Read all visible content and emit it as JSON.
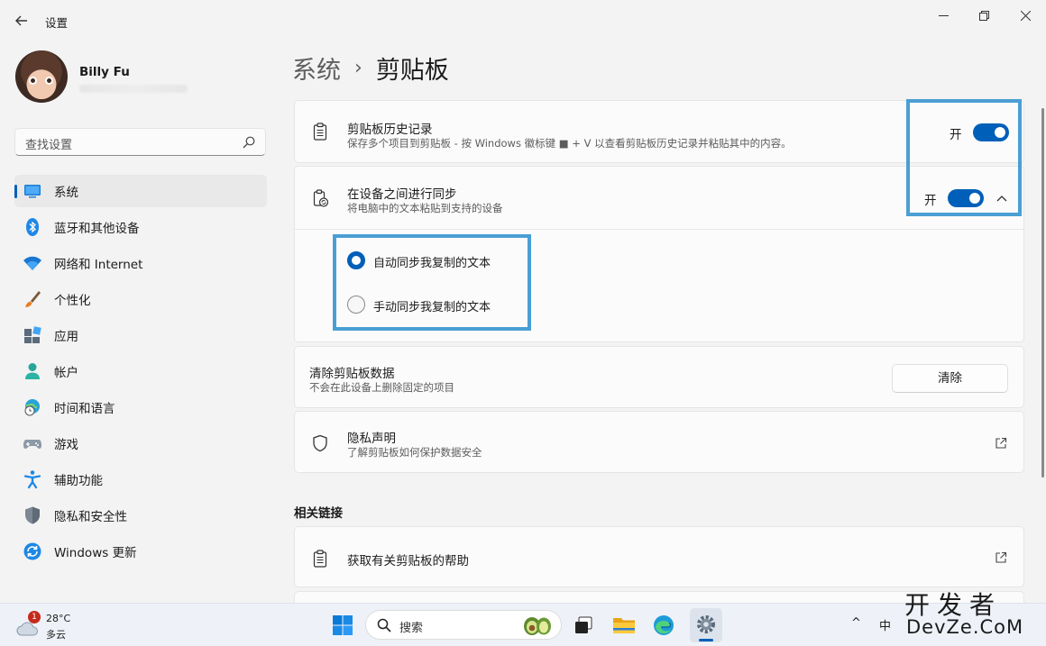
{
  "window": {
    "title": "设置"
  },
  "profile": {
    "name": "Billy Fu"
  },
  "search": {
    "placeholder": "查找设置"
  },
  "sidebar": {
    "items": [
      {
        "label": "系统",
        "icon": "system-icon"
      },
      {
        "label": "蓝牙和其他设备",
        "icon": "bluetooth-icon"
      },
      {
        "label": "网络和 Internet",
        "icon": "wifi-icon"
      },
      {
        "label": "个性化",
        "icon": "brush-icon"
      },
      {
        "label": "应用",
        "icon": "apps-icon"
      },
      {
        "label": "帐户",
        "icon": "account-icon"
      },
      {
        "label": "时间和语言",
        "icon": "globe-clock-icon"
      },
      {
        "label": "游戏",
        "icon": "gamepad-icon"
      },
      {
        "label": "辅助功能",
        "icon": "accessibility-icon"
      },
      {
        "label": "隐私和安全性",
        "icon": "shield-icon"
      },
      {
        "label": "Windows 更新",
        "icon": "update-icon"
      }
    ],
    "active_index": 0
  },
  "breadcrumb": {
    "parent": "系统",
    "separator": "›",
    "current": "剪贴板"
  },
  "clipboard_history": {
    "title": "剪贴板历史记录",
    "subtitle": "保存多个项目到剪贴板 - 按 Windows 徽标键 ■ + V 以查看剪贴板历史记录并粘贴其中的内容。",
    "toggle_label": "开",
    "enabled": true
  },
  "sync": {
    "title": "在设备之间进行同步",
    "subtitle": "将电脑中的文本粘贴到支持的设备",
    "toggle_label": "开",
    "enabled": true,
    "options": [
      {
        "label": "自动同步我复制的文本",
        "selected": true
      },
      {
        "label": "手动同步我复制的文本",
        "selected": false
      }
    ]
  },
  "clear": {
    "title": "清除剪贴板数据",
    "subtitle": "不会在此设备上删除固定的项目",
    "button_label": "清除"
  },
  "privacy": {
    "title": "隐私声明",
    "subtitle": "了解剪贴板如何保护数据安全"
  },
  "related": {
    "heading": "相关链接",
    "help_label": "获取有关剪贴板的帮助"
  },
  "taskbar": {
    "weather_badge": "1",
    "temperature": "28°C",
    "condition": "多云",
    "search_placeholder": "搜索",
    "tray_ime": "中",
    "tray_chevron": "^"
  },
  "watermark": {
    "line1": "开发者",
    "line2": "DevZe.CoM"
  },
  "colors": {
    "accent": "#005fb8",
    "highlight_box": "#4a9fd4"
  }
}
